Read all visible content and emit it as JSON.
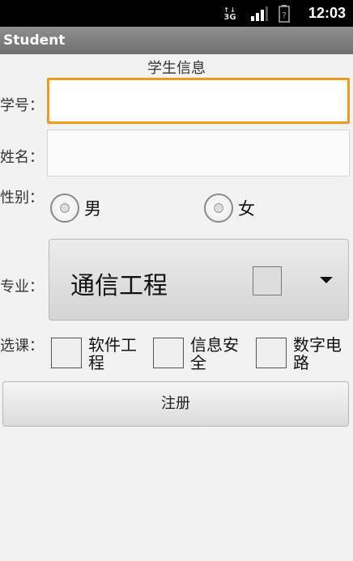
{
  "status_bar": {
    "network": "3G",
    "time": "12:03"
  },
  "app": {
    "title": "Student"
  },
  "form": {
    "heading": "学生信息",
    "student_id_label": "学号：",
    "student_id_value": "",
    "name_label": "姓名：",
    "name_value": "",
    "gender_label": "性别：",
    "gender_options": [
      "男",
      "女"
    ],
    "major_label": "专业：",
    "major_selected": "通信工程",
    "courses_label": "选课：",
    "courses": [
      {
        "label_line1": "软件工",
        "label_line2": "程"
      },
      {
        "label_line1": "信息安",
        "label_line2": "全"
      },
      {
        "label_line1": "数字电",
        "label_line2": "路"
      }
    ],
    "submit_label": "注册"
  }
}
